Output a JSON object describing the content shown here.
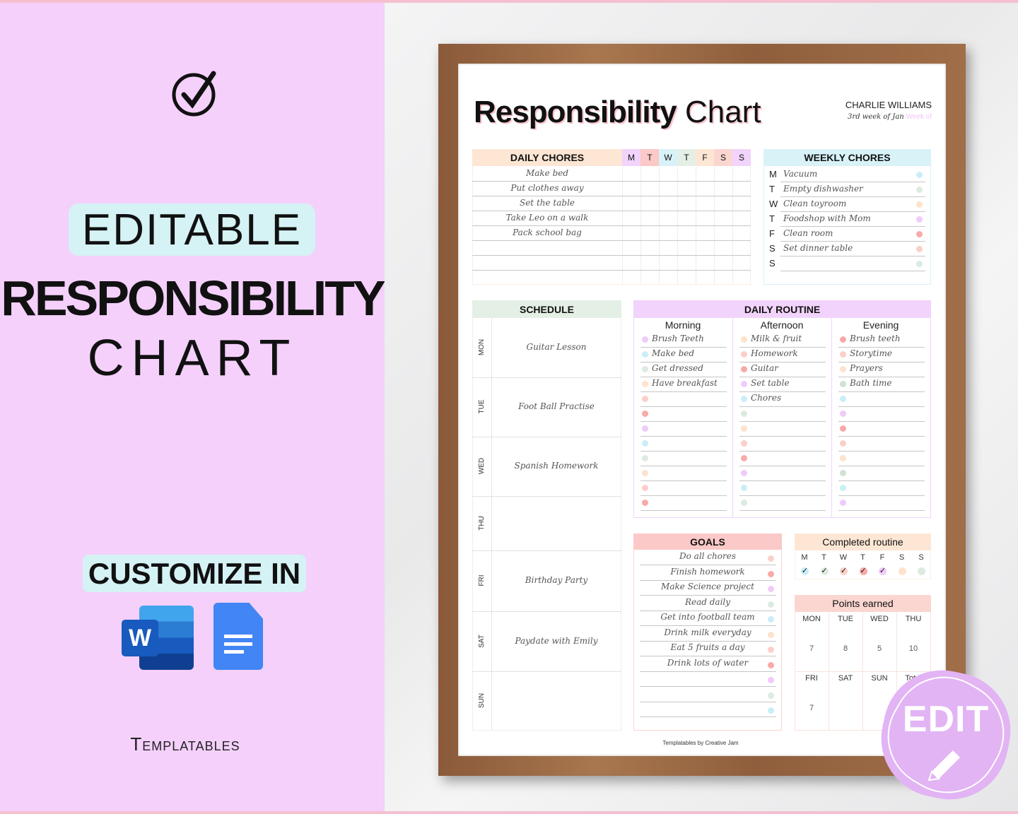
{
  "promo": {
    "editable": "EDITABLE",
    "title_bold": "RESPONSIBILITY",
    "title_light": "CHART",
    "customize": "CUSTOMIZE IN",
    "brand": "Templatables",
    "badge": "EDIT",
    "word_letter": "W"
  },
  "chart": {
    "title_bold": "Responsibility",
    "title_light": "Chart",
    "name": "CHARLIE WILLIAMS",
    "week": "3rd week of Jan",
    "week_placeholder": "Week of",
    "daily_chores": {
      "title": "DAILY CHORES",
      "days": [
        "M",
        "T",
        "W",
        "T",
        "F",
        "S",
        "S"
      ],
      "day_colors": [
        "#f1d3fb",
        "#fbc9c7",
        "#d8f2f8",
        "#e4efe6",
        "#fde6d4",
        "#fbd6d1",
        "#f1d3fb"
      ],
      "items": [
        "Make bed",
        "Put clothes away",
        "Set the table",
        "Take Leo on a walk",
        "Pack school bag",
        "",
        "",
        ""
      ]
    },
    "weekly_chores": {
      "title": "WEEKLY CHORES",
      "items": [
        {
          "day": "M",
          "task": "Vacuum",
          "color": "#c9eef8"
        },
        {
          "day": "T",
          "task": "Empty dishwasher",
          "color": "#dcebdf"
        },
        {
          "day": "W",
          "task": "Clean toyroom",
          "color": "#fde3cc"
        },
        {
          "day": "T",
          "task": "Foodshop with Mom",
          "color": "#efcbfa"
        },
        {
          "day": "F",
          "task": "Clean room",
          "color": "#f8aaa8"
        },
        {
          "day": "S",
          "task": "Set dinner table",
          "color": "#fbcfc9"
        },
        {
          "day": "S",
          "task": "",
          "color": "#dcebdf"
        }
      ]
    },
    "schedule": {
      "title": "SCHEDULE",
      "rows": [
        {
          "day": "MON",
          "event": "Guitar Lesson"
        },
        {
          "day": "TUE",
          "event": "Foot Ball Practise"
        },
        {
          "day": "WED",
          "event": "Spanish Homework"
        },
        {
          "day": "THU",
          "event": ""
        },
        {
          "day": "FRI",
          "event": "Birthday Party"
        },
        {
          "day": "SAT",
          "event": "Paydate with Emily"
        },
        {
          "day": "SUN",
          "event": ""
        }
      ]
    },
    "daily_routine": {
      "title": "DAILY ROUTINE",
      "columns": [
        {
          "name": "Morning",
          "items": [
            "Brush Teeth",
            "Make bed",
            "Get dressed",
            "Have breakfast",
            "",
            "",
            "",
            "",
            "",
            "",
            "",
            "",
            ""
          ],
          "colors": [
            "#efcbfa",
            "#c9eef8",
            "#dcebdf",
            "#fde3cc",
            "#fbcfc9",
            "#f8aaa8",
            "#efcbfa",
            "#c9eef8",
            "#dcebdf",
            "#fde3cc",
            "#fbcfc9",
            "#f8aaa8"
          ]
        },
        {
          "name": "Afternoon",
          "items": [
            "Milk & fruit",
            "Homework",
            "Guitar",
            "Set table",
            "Chores",
            "",
            "",
            "",
            "",
            "",
            "",
            "",
            ""
          ],
          "colors": [
            "#fde3cc",
            "#fbcfc9",
            "#f8aaa8",
            "#efcbfa",
            "#c9eef8",
            "#dcebdf",
            "#fde3cc",
            "#fbcfc9",
            "#f8aaa8",
            "#efcbfa",
            "#c9eef8",
            "#dcebdf"
          ]
        },
        {
          "name": "Evening",
          "items": [
            "Brush teeth",
            "Storytime",
            "Prayers",
            "Bath time",
            "",
            "",
            "",
            "",
            "",
            "",
            "",
            "",
            ""
          ],
          "colors": [
            "#f8aaa8",
            "#fbcfc9",
            "#fde3cc",
            "#cfe3d3",
            "#c9eef8",
            "#efcbfa",
            "#f8aaa8",
            "#fbcfc9",
            "#fde3cc",
            "#cfe3d3",
            "#c9eef8",
            "#efcbfa"
          ]
        }
      ]
    },
    "goals": {
      "title": "GOALS",
      "items": [
        "Do all chores",
        "Finish homework",
        "Make Science project",
        "Read daily",
        "Get into football team",
        "Drink milk everyday",
        "Eat 5 fruits a day",
        "Drink lots of water",
        "",
        "",
        ""
      ],
      "colors": [
        "#fbcfc9",
        "#f8aaa8",
        "#efcbfa",
        "#dcebdf",
        "#c9eef8",
        "#fde3cc",
        "#fbcfc9",
        "#f8aaa8",
        "#efcbfa",
        "#dcebdf",
        "#c9eef8"
      ]
    },
    "completed_routine": {
      "title": "Completed routine",
      "days": [
        "M",
        "T",
        "W",
        "T",
        "F",
        "S",
        "S"
      ],
      "checked": [
        true,
        true,
        true,
        true,
        true,
        false,
        false
      ],
      "check_mark": "✓",
      "colors": [
        "#c9eef8",
        "#dcebdf",
        "#fbcfc9",
        "#f8aaa8",
        "#efcbfa",
        "#fde3cc",
        "#dcebdf"
      ]
    },
    "points_earned": {
      "title": "Points earned",
      "labels": [
        "MON",
        "TUE",
        "WED",
        "THU",
        "FRI",
        "SAT",
        "SUN",
        "Total"
      ],
      "values": [
        "7",
        "8",
        "5",
        "10",
        "7",
        "",
        "",
        ""
      ]
    },
    "footer": "Templatables by Creative Jam"
  },
  "colors": {
    "left_bg": "#f4d0fb",
    "pill_bg": "#d5f2f5",
    "badge": "#e2b4f4"
  }
}
